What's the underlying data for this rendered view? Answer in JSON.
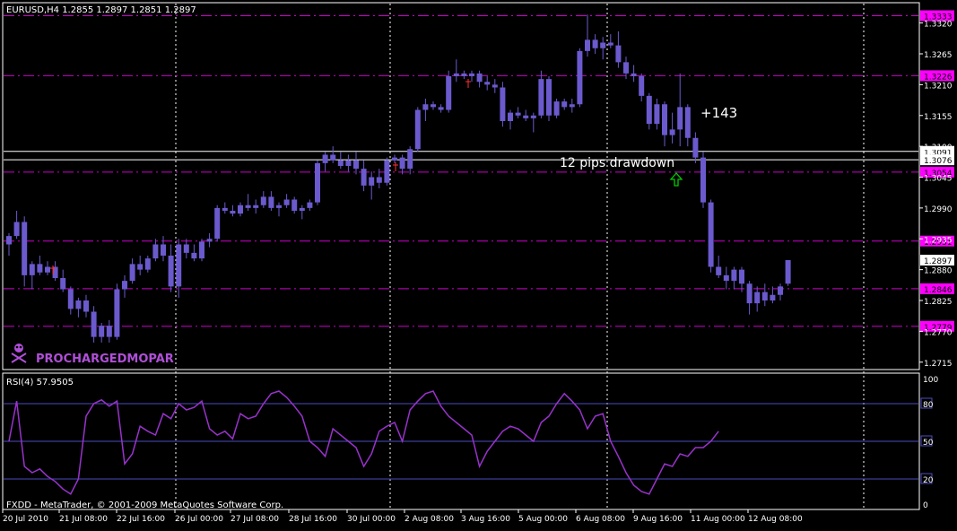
{
  "app": {
    "symbol_header": "EURUSD,H4  1.2855 1.2897 1.2851 1.2897",
    "copyright": "FXDD - MetaTrader, © 2001-2009 MetaQuotes Software Corp.",
    "watermark": "PROCHARGEDMOPAR",
    "colors": {
      "background": "#000000",
      "candle": "#6a5acd",
      "level_line": "#cc00cc",
      "level_label_bg": "#ff00ff",
      "rsi_line": "#9932cc",
      "rsi_levels": "#4b4bbf",
      "grid": "#ffffff",
      "annotation": "#ffffff",
      "arrow": "#00cc00"
    }
  },
  "annotations": {
    "profit_text": "+143",
    "drawdown_text": "12 pips drawdown"
  },
  "price_axis": {
    "labels": [
      "1.3320",
      "1.3265",
      "1.3210",
      "1.3155",
      "1.3100",
      "1.3045",
      "1.2990",
      "1.2935",
      "1.2880",
      "1.2825",
      "1.2770",
      "1.2715"
    ],
    "current_price": "1.2897",
    "white_levels": [
      "1.3091",
      "1.3076"
    ],
    "magenta_levels": [
      "1.3333",
      "1.3226",
      "1.3054",
      "1.2931",
      "1.2846",
      "1.2779"
    ]
  },
  "rsi": {
    "title": "RSI(4) 57.9505",
    "axis_labels": [
      "100",
      "80",
      "50",
      "20",
      "0"
    ],
    "level_values": [
      "80",
      "50",
      "20"
    ]
  },
  "time_axis": {
    "labels": [
      "20 Jul 2010",
      "21 Jul 08:00",
      "22 Jul 16:00",
      "26 Jul 00:00",
      "27 Jul 08:00",
      "28 Jul 16:00",
      "30 Jul 00:00",
      "2 Aug 08:00",
      "3 Aug 16:00",
      "5 Aug 00:00",
      "6 Aug 08:00",
      "9 Aug 16:00",
      "11 Aug 00:00",
      "12 Aug 08:00"
    ]
  },
  "chart_data": {
    "type": "candlestick",
    "price_range": [
      1.2705,
      1.3345
    ],
    "rsi_range": [
      0,
      100
    ],
    "candles": [
      {
        "o": 1.2925,
        "h": 1.2945,
        "l": 1.2905,
        "c": 1.294
      },
      {
        "o": 1.294,
        "h": 1.2985,
        "l": 1.2935,
        "c": 1.2965
      },
      {
        "o": 1.2965,
        "h": 1.2975,
        "l": 1.285,
        "c": 1.287
      },
      {
        "o": 1.287,
        "h": 1.2895,
        "l": 1.2845,
        "c": 1.289
      },
      {
        "o": 1.289,
        "h": 1.2905,
        "l": 1.287,
        "c": 1.2875
      },
      {
        "o": 1.2875,
        "h": 1.2895,
        "l": 1.287,
        "c": 1.2885
      },
      {
        "o": 1.2885,
        "h": 1.2895,
        "l": 1.286,
        "c": 1.2865
      },
      {
        "o": 1.2865,
        "h": 1.288,
        "l": 1.284,
        "c": 1.2845
      },
      {
        "o": 1.2845,
        "h": 1.285,
        "l": 1.28,
        "c": 1.281
      },
      {
        "o": 1.281,
        "h": 1.283,
        "l": 1.2795,
        "c": 1.2825
      },
      {
        "o": 1.2825,
        "h": 1.2835,
        "l": 1.2795,
        "c": 1.2805
      },
      {
        "o": 1.2805,
        "h": 1.2815,
        "l": 1.275,
        "c": 1.276
      },
      {
        "o": 1.276,
        "h": 1.2785,
        "l": 1.275,
        "c": 1.278
      },
      {
        "o": 1.278,
        "h": 1.279,
        "l": 1.275,
        "c": 1.276
      },
      {
        "o": 1.276,
        "h": 1.2855,
        "l": 1.2755,
        "c": 1.2845
      },
      {
        "o": 1.2845,
        "h": 1.287,
        "l": 1.283,
        "c": 1.286
      },
      {
        "o": 1.286,
        "h": 1.29,
        "l": 1.2855,
        "c": 1.289
      },
      {
        "o": 1.289,
        "h": 1.2905,
        "l": 1.287,
        "c": 1.288
      },
      {
        "o": 1.288,
        "h": 1.2905,
        "l": 1.2875,
        "c": 1.29
      },
      {
        "o": 1.29,
        "h": 1.2935,
        "l": 1.2895,
        "c": 1.2925
      },
      {
        "o": 1.2925,
        "h": 1.294,
        "l": 1.2895,
        "c": 1.2905
      },
      {
        "o": 1.2905,
        "h": 1.2925,
        "l": 1.284,
        "c": 1.285
      },
      {
        "o": 1.285,
        "h": 1.2935,
        "l": 1.283,
        "c": 1.2925
      },
      {
        "o": 1.2925,
        "h": 1.2935,
        "l": 1.29,
        "c": 1.291
      },
      {
        "o": 1.291,
        "h": 1.2925,
        "l": 1.2895,
        "c": 1.29
      },
      {
        "o": 1.29,
        "h": 1.2935,
        "l": 1.2895,
        "c": 1.293
      },
      {
        "o": 1.293,
        "h": 1.2945,
        "l": 1.292,
        "c": 1.2935
      },
      {
        "o": 1.2935,
        "h": 1.2995,
        "l": 1.293,
        "c": 1.299
      },
      {
        "o": 1.299,
        "h": 1.3,
        "l": 1.298,
        "c": 1.2985
      },
      {
        "o": 1.2985,
        "h": 1.2995,
        "l": 1.2975,
        "c": 1.298
      },
      {
        "o": 1.298,
        "h": 1.3,
        "l": 1.2975,
        "c": 1.2995
      },
      {
        "o": 1.2995,
        "h": 1.3015,
        "l": 1.2985,
        "c": 1.299
      },
      {
        "o": 1.299,
        "h": 1.3005,
        "l": 1.298,
        "c": 1.2995
      },
      {
        "o": 1.2995,
        "h": 1.302,
        "l": 1.299,
        "c": 1.301
      },
      {
        "o": 1.301,
        "h": 1.302,
        "l": 1.2985,
        "c": 1.299
      },
      {
        "o": 1.299,
        "h": 1.3,
        "l": 1.2975,
        "c": 1.2995
      },
      {
        "o": 1.2995,
        "h": 1.3015,
        "l": 1.299,
        "c": 1.3005
      },
      {
        "o": 1.3005,
        "h": 1.301,
        "l": 1.298,
        "c": 1.2985
      },
      {
        "o": 1.2985,
        "h": 1.2995,
        "l": 1.297,
        "c": 1.299
      },
      {
        "o": 1.299,
        "h": 1.3005,
        "l": 1.2985,
        "c": 1.3
      },
      {
        "o": 1.3,
        "h": 1.3075,
        "l": 1.2995,
        "c": 1.307
      },
      {
        "o": 1.307,
        "h": 1.309,
        "l": 1.3055,
        "c": 1.3085
      },
      {
        "o": 1.3085,
        "h": 1.31,
        "l": 1.307,
        "c": 1.3075
      },
      {
        "o": 1.3075,
        "h": 1.309,
        "l": 1.306,
        "c": 1.3065
      },
      {
        "o": 1.3065,
        "h": 1.3085,
        "l": 1.3055,
        "c": 1.3075
      },
      {
        "o": 1.3075,
        "h": 1.309,
        "l": 1.305,
        "c": 1.306
      },
      {
        "o": 1.306,
        "h": 1.3075,
        "l": 1.302,
        "c": 1.303
      },
      {
        "o": 1.303,
        "h": 1.3055,
        "l": 1.3005,
        "c": 1.3045
      },
      {
        "o": 1.3045,
        "h": 1.306,
        "l": 1.3025,
        "c": 1.3035
      },
      {
        "o": 1.3035,
        "h": 1.308,
        "l": 1.303,
        "c": 1.3075
      },
      {
        "o": 1.3075,
        "h": 1.3085,
        "l": 1.307,
        "c": 1.308
      },
      {
        "o": 1.308,
        "h": 1.3085,
        "l": 1.305,
        "c": 1.306
      },
      {
        "o": 1.306,
        "h": 1.31,
        "l": 1.305,
        "c": 1.3095
      },
      {
        "o": 1.3095,
        "h": 1.317,
        "l": 1.309,
        "c": 1.3165
      },
      {
        "o": 1.3165,
        "h": 1.3185,
        "l": 1.3145,
        "c": 1.3175
      },
      {
        "o": 1.3175,
        "h": 1.318,
        "l": 1.3165,
        "c": 1.317
      },
      {
        "o": 1.317,
        "h": 1.3175,
        "l": 1.316,
        "c": 1.3165
      },
      {
        "o": 1.3165,
        "h": 1.3235,
        "l": 1.316,
        "c": 1.3225
      },
      {
        "o": 1.3225,
        "h": 1.3255,
        "l": 1.3215,
        "c": 1.323
      },
      {
        "o": 1.323,
        "h": 1.3235,
        "l": 1.322,
        "c": 1.3225
      },
      {
        "o": 1.3225,
        "h": 1.3235,
        "l": 1.3215,
        "c": 1.323
      },
      {
        "o": 1.323,
        "h": 1.3235,
        "l": 1.3205,
        "c": 1.3215
      },
      {
        "o": 1.3215,
        "h": 1.3225,
        "l": 1.32,
        "c": 1.321
      },
      {
        "o": 1.321,
        "h": 1.322,
        "l": 1.3195,
        "c": 1.3205
      },
      {
        "o": 1.3205,
        "h": 1.3215,
        "l": 1.3135,
        "c": 1.3145
      },
      {
        "o": 1.3145,
        "h": 1.3165,
        "l": 1.313,
        "c": 1.316
      },
      {
        "o": 1.316,
        "h": 1.317,
        "l": 1.315,
        "c": 1.3155
      },
      {
        "o": 1.3155,
        "h": 1.3165,
        "l": 1.3145,
        "c": 1.315
      },
      {
        "o": 1.315,
        "h": 1.316,
        "l": 1.3125,
        "c": 1.3155
      },
      {
        "o": 1.3155,
        "h": 1.3235,
        "l": 1.315,
        "c": 1.322
      },
      {
        "o": 1.322,
        "h": 1.3225,
        "l": 1.3145,
        "c": 1.3155
      },
      {
        "o": 1.3155,
        "h": 1.3185,
        "l": 1.315,
        "c": 1.318
      },
      {
        "o": 1.318,
        "h": 1.3185,
        "l": 1.3165,
        "c": 1.317
      },
      {
        "o": 1.317,
        "h": 1.3185,
        "l": 1.316,
        "c": 1.3175
      },
      {
        "o": 1.3175,
        "h": 1.3275,
        "l": 1.317,
        "c": 1.327
      },
      {
        "o": 1.327,
        "h": 1.3335,
        "l": 1.326,
        "c": 1.329
      },
      {
        "o": 1.329,
        "h": 1.33,
        "l": 1.3265,
        "c": 1.3275
      },
      {
        "o": 1.3275,
        "h": 1.3295,
        "l": 1.3255,
        "c": 1.3285
      },
      {
        "o": 1.3285,
        "h": 1.33,
        "l": 1.3275,
        "c": 1.328
      },
      {
        "o": 1.328,
        "h": 1.3305,
        "l": 1.324,
        "c": 1.325
      },
      {
        "o": 1.325,
        "h": 1.326,
        "l": 1.322,
        "c": 1.323
      },
      {
        "o": 1.323,
        "h": 1.3245,
        "l": 1.3215,
        "c": 1.3225
      },
      {
        "o": 1.3225,
        "h": 1.323,
        "l": 1.318,
        "c": 1.319
      },
      {
        "o": 1.319,
        "h": 1.3195,
        "l": 1.313,
        "c": 1.314
      },
      {
        "o": 1.314,
        "h": 1.3185,
        "l": 1.313,
        "c": 1.3175
      },
      {
        "o": 1.3175,
        "h": 1.318,
        "l": 1.31,
        "c": 1.312
      },
      {
        "o": 1.312,
        "h": 1.316,
        "l": 1.3105,
        "c": 1.313
      },
      {
        "o": 1.313,
        "h": 1.323,
        "l": 1.31,
        "c": 1.317
      },
      {
        "o": 1.317,
        "h": 1.3175,
        "l": 1.31,
        "c": 1.3115
      },
      {
        "o": 1.3115,
        "h": 1.3125,
        "l": 1.307,
        "c": 1.308
      },
      {
        "o": 1.308,
        "h": 1.309,
        "l": 1.299,
        "c": 1.3
      },
      {
        "o": 1.3,
        "h": 1.3005,
        "l": 1.2875,
        "c": 1.2885
      },
      {
        "o": 1.2885,
        "h": 1.2905,
        "l": 1.2865,
        "c": 1.287
      },
      {
        "o": 1.287,
        "h": 1.2885,
        "l": 1.2845,
        "c": 1.286
      },
      {
        "o": 1.286,
        "h": 1.2885,
        "l": 1.2845,
        "c": 1.288
      },
      {
        "o": 1.288,
        "h": 1.2885,
        "l": 1.284,
        "c": 1.2855
      },
      {
        "o": 1.2855,
        "h": 1.286,
        "l": 1.28,
        "c": 1.282
      },
      {
        "o": 1.282,
        "h": 1.285,
        "l": 1.2805,
        "c": 1.284
      },
      {
        "o": 1.284,
        "h": 1.2855,
        "l": 1.2815,
        "c": 1.2825
      },
      {
        "o": 1.2825,
        "h": 1.285,
        "l": 1.282,
        "c": 1.2835
      },
      {
        "o": 1.2835,
        "h": 1.2855,
        "l": 1.2825,
        "c": 1.285
      },
      {
        "o": 1.2855,
        "h": 1.2897,
        "l": 1.2851,
        "c": 1.2897
      }
    ],
    "rsi_values": [
      50,
      82,
      30,
      25,
      28,
      22,
      18,
      12,
      8,
      20,
      70,
      80,
      83,
      78,
      82,
      32,
      40,
      62,
      58,
      55,
      72,
      68,
      80,
      75,
      77,
      82,
      60,
      55,
      58,
      52,
      72,
      68,
      70,
      80,
      88,
      90,
      85,
      78,
      70,
      50,
      45,
      38,
      60,
      55,
      50,
      45,
      30,
      40,
      58,
      62,
      65,
      50,
      75,
      82,
      88,
      90,
      78,
      70,
      65,
      60,
      55,
      30,
      42,
      50,
      58,
      62,
      60,
      55,
      50,
      65,
      70,
      80,
      88,
      82,
      75,
      60,
      70,
      72,
      50,
      38,
      25,
      15,
      10,
      8,
      20,
      32,
      30,
      40,
      38,
      45,
      45,
      50,
      58
    ]
  }
}
